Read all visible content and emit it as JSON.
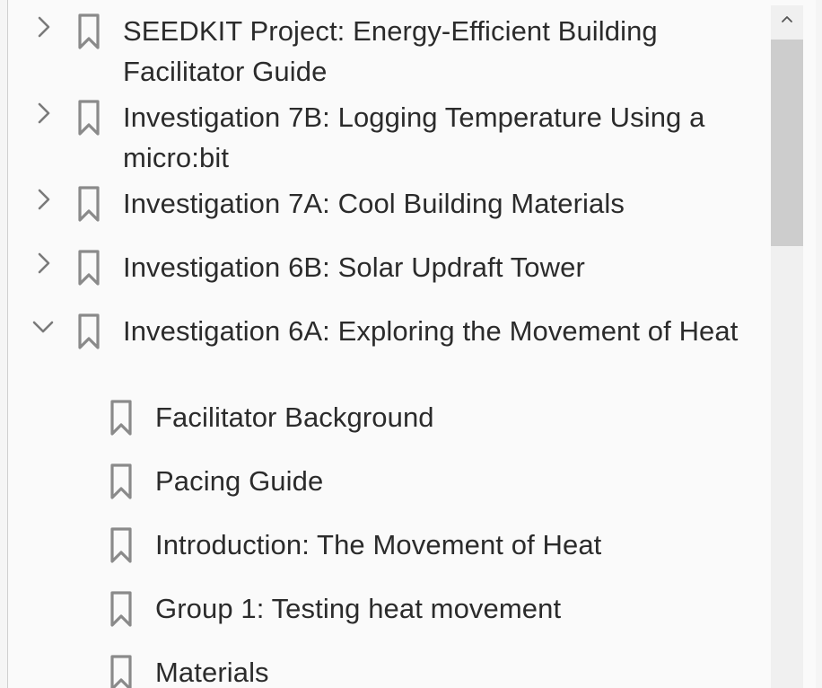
{
  "bookmarks": {
    "items": [
      {
        "label": "SEEDKIT Project: Energy-Efficient Building Facilitator Guide",
        "state": "collapsed"
      },
      {
        "label": "Investigation 7B: Logging Temperature Using a micro:bit",
        "state": "collapsed"
      },
      {
        "label": "Investigation 7A: Cool Building Materials",
        "state": "collapsed"
      },
      {
        "label": "Investigation 6B: Solar Updraft Tower",
        "state": "collapsed"
      },
      {
        "label": "Investigation 6A: Exploring the Movement of Heat",
        "state": "expanded"
      }
    ],
    "children": [
      {
        "label": "Facilitator Background"
      },
      {
        "label": "Pacing Guide"
      },
      {
        "label": "Introduction: The Movement of Heat"
      },
      {
        "label": "Group 1: Testing heat movement"
      },
      {
        "label": "Materials"
      }
    ]
  },
  "icons": {
    "expand": "chevron-right-icon",
    "collapse": "chevron-down-icon",
    "bookmark": "bookmark-icon",
    "scroll_up": "scroll-up-arrow-icon"
  },
  "colors": {
    "icon": "#8a8a8a",
    "text": "#2b2b2b",
    "thumb": "#cdcdcd"
  }
}
